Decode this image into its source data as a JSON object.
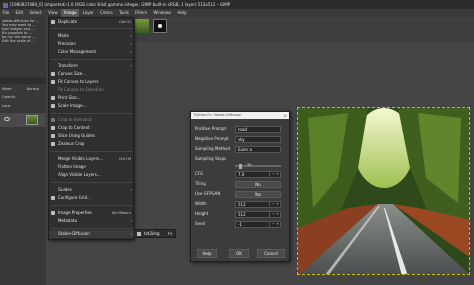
{
  "window": {
    "title": "[1980837480_0] (imported)-1.0 (RGB color 8-bit gamma integer, GIMP built-in sRGB, 1 layer) 512x512 – GIMP"
  },
  "menubar": {
    "items": [
      "File",
      "Edit",
      "Select",
      "View",
      "Image",
      "Layer",
      "Colors",
      "Tools",
      "Filters",
      "Windows",
      "Help"
    ],
    "active": "Image"
  },
  "left_panel": {
    "text_lines": [
      "stable-diffusion for ...",
      "You may want to ...",
      "tool images and ...",
      "It's possible to ...",
      "be run the same ...",
      "Edit the scale of ..."
    ],
    "mode_label": "Mode",
    "mode_value": "Normal",
    "opacity_label": "Opacity",
    "lock_label": "Lock:"
  },
  "image_menu": {
    "items": [
      {
        "label": "Duplicate",
        "shortcut": "Ctrl+D",
        "icon": "duplicate-icon"
      },
      {
        "label": "Mode",
        "submenu": true
      },
      {
        "label": "Precision",
        "submenu": true
      },
      {
        "label": "Color Management",
        "submenu": true
      },
      {
        "label": "Transform",
        "submenu": true
      },
      {
        "label": "Canvas Size...",
        "icon": "canvas-size-icon"
      },
      {
        "label": "Fit Canvas to Layers",
        "icon": "fit-canvas-icon"
      },
      {
        "label": "Fit Canvas to Selection",
        "disabled": true
      },
      {
        "label": "Print Size...",
        "icon": "print-size-icon"
      },
      {
        "label": "Scale Image...",
        "icon": "scale-image-icon"
      },
      {
        "label": "Crop to Selection",
        "disabled": true,
        "icon": "crop-icon"
      },
      {
        "label": "Crop to Content",
        "icon": "crop-content-icon"
      },
      {
        "label": "Slice Using Guides",
        "icon": "slice-icon"
      },
      {
        "label": "Zealous Crop",
        "icon": "zealous-crop-icon"
      },
      {
        "label": "Merge Visible Layers...",
        "shortcut": "Ctrl+M"
      },
      {
        "label": "Flatten Image"
      },
      {
        "label": "Align Visible Layers..."
      },
      {
        "label": "Guides",
        "submenu": true
      },
      {
        "label": "Configure Grid...",
        "icon": "grid-icon"
      },
      {
        "label": "Image Properties",
        "shortcut": "Alt+Return",
        "icon": "properties-icon"
      },
      {
        "label": "Metadata",
        "submenu": true
      },
      {
        "label": "Stable-Diffusion",
        "submenu": true
      }
    ]
  },
  "submenu": {
    "label": "txt2img",
    "shortcut": "F3"
  },
  "dialog": {
    "title": "Python-Fu: Stable-Diffusion",
    "fields": [
      {
        "label": "Positive Prompt",
        "value": "road"
      },
      {
        "label": "Negative Prompt",
        "value": "sky"
      },
      {
        "label": "Sampling Method",
        "value": "Euler a"
      },
      {
        "label": "Sampling Steps",
        "value": "30"
      },
      {
        "label": "CFG",
        "value": "7.0"
      },
      {
        "label": "Tiling",
        "value": "No"
      },
      {
        "label": "Use GFPGAN",
        "value": "Yes"
      },
      {
        "label": "Width",
        "value": "512"
      },
      {
        "label": "Height",
        "value": "512"
      },
      {
        "label": "Seed",
        "value": "-1"
      }
    ],
    "buttons": {
      "help": "Help",
      "ok": "OK",
      "cancel": "Cancel"
    }
  }
}
